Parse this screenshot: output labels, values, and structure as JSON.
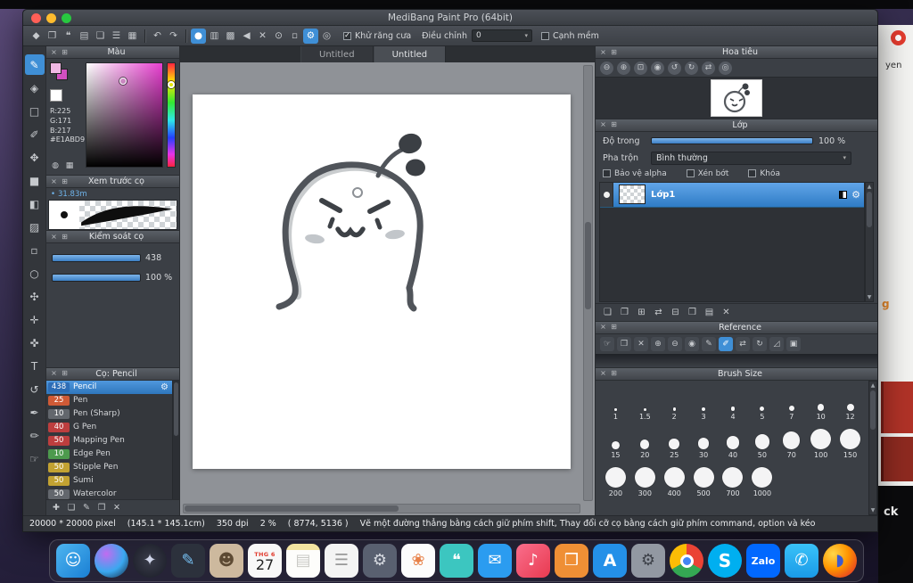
{
  "window": {
    "title": "MediBang Paint Pro (64bit)"
  },
  "toolbar": {
    "antialias_label": "Khử răng cưa",
    "antialias_checked": true,
    "adjust_label": "Điều chỉnh",
    "adjust_value": "0",
    "soft_edge_label": "Cạnh mềm",
    "soft_edge_checked": false,
    "icons": [
      {
        "name": "blob-select-icon",
        "glyph": "◆"
      },
      {
        "name": "transform-icon",
        "glyph": "❐"
      },
      {
        "name": "speech-bubble-icon",
        "glyph": "❝"
      },
      {
        "name": "text-panel-icon",
        "glyph": "▤"
      },
      {
        "name": "page-icon",
        "glyph": "❏"
      },
      {
        "name": "list-icon",
        "glyph": "☰"
      },
      {
        "name": "grid-icon",
        "glyph": "▦"
      },
      {
        "sep": true
      },
      {
        "name": "undo-icon",
        "glyph": "↶"
      },
      {
        "name": "redo-icon",
        "glyph": "↷"
      },
      {
        "sep": true
      },
      {
        "name": "brush-circle-icon",
        "glyph": "●",
        "active": true
      },
      {
        "name": "gradient-icon",
        "glyph": "▥"
      },
      {
        "name": "pattern-icon",
        "glyph": "▩"
      },
      {
        "name": "snap-left-icon",
        "glyph": "◀"
      },
      {
        "name": "cross-snap-icon",
        "glyph": "✕"
      },
      {
        "name": "rotate-canvas-icon",
        "glyph": "⊙"
      },
      {
        "name": "select-rect-icon",
        "glyph": "▫"
      },
      {
        "name": "brush-settings-icon",
        "glyph": "⚙",
        "active": true
      },
      {
        "name": "circle-tool-icon",
        "glyph": "◎"
      }
    ]
  },
  "toolstrip": {
    "tools": [
      {
        "name": "pen-tool",
        "glyph": "✎",
        "active": true
      },
      {
        "name": "eraser-tool",
        "glyph": "◈"
      },
      {
        "name": "marquee-tool",
        "glyph": "□"
      },
      {
        "name": "brush-tool",
        "glyph": "✐"
      },
      {
        "name": "move-tool",
        "glyph": "✥"
      },
      {
        "name": "fill-rect-tool",
        "glyph": "■"
      },
      {
        "name": "bucket-tool",
        "glyph": "◧"
      },
      {
        "name": "gradient-tool",
        "glyph": "▨"
      },
      {
        "name": "select-tool",
        "glyph": "▫"
      },
      {
        "name": "lasso-tool",
        "glyph": "○"
      },
      {
        "name": "magic-wand-tool",
        "glyph": "✣"
      },
      {
        "name": "divide-tool",
        "glyph": "✛"
      },
      {
        "name": "eyedropper-tool",
        "glyph": "✜"
      },
      {
        "name": "text-tool",
        "glyph": "T"
      },
      {
        "name": "rotate-tool",
        "glyph": "↺"
      },
      {
        "name": "pen2-tool",
        "glyph": "✒"
      },
      {
        "name": "pencil-tool",
        "glyph": "✏"
      },
      {
        "name": "hand-tool",
        "glyph": "☞"
      }
    ]
  },
  "tabs": [
    {
      "label": "Untitled"
    },
    {
      "label": "Untitled",
      "active": true
    }
  ],
  "panels": {
    "color": {
      "title": "Màu",
      "r": "R:225",
      "g": "G:171",
      "b": "B:217",
      "hex": "#E1ABD9",
      "icons": [
        {
          "name": "web-color-icon",
          "glyph": "◍"
        },
        {
          "name": "palette-icon",
          "glyph": "▦"
        }
      ]
    },
    "preview": {
      "title": "Xem trước cọ",
      "size_label": "31.83m"
    },
    "control": {
      "title": "Kiểm soát cọ",
      "slider1_value": "438",
      "slider2_value": "100 %"
    },
    "brushes": {
      "title": "Cọ: Pencil",
      "items": [
        {
          "size": "438",
          "name": "Pencil",
          "selected": true,
          "chip": "#2e6db6"
        },
        {
          "size": "25",
          "name": "Pen",
          "chip": "#cf5a36"
        },
        {
          "size": "10",
          "name": "Pen (Sharp)",
          "chip": "#63676d"
        },
        {
          "size": "40",
          "name": "G Pen",
          "chip": "#bd3e3e"
        },
        {
          "size": "50",
          "name": "Mapping Pen",
          "chip": "#bd3e3e"
        },
        {
          "size": "10",
          "name": "Edge Pen",
          "chip": "#4d9a4d"
        },
        {
          "size": "50",
          "name": "Stipple Pen",
          "chip": "#c2a232"
        },
        {
          "size": "50",
          "name": "Sumi",
          "chip": "#c2a232"
        },
        {
          "size": "50",
          "name": "Watercolor",
          "chip": "#63676d"
        }
      ],
      "toolbar_icons": [
        {
          "name": "add-brush-icon",
          "glyph": "✚"
        },
        {
          "name": "duplicate-brush-icon",
          "glyph": "❏"
        },
        {
          "name": "edit-brush-icon",
          "glyph": "✎"
        },
        {
          "name": "brush-folder-icon",
          "glyph": "❒"
        },
        {
          "name": "delete-brush-icon",
          "glyph": "✕"
        }
      ]
    },
    "navigator": {
      "title": "Hoa tiêu",
      "icons": [
        {
          "name": "zoom-out-icon",
          "glyph": "⊖"
        },
        {
          "name": "zoom-in-icon",
          "glyph": "⊕"
        },
        {
          "name": "fit-window-icon",
          "glyph": "⊡"
        },
        {
          "name": "actual-size-icon",
          "glyph": "◉"
        },
        {
          "name": "rotate-left-icon",
          "glyph": "↺"
        },
        {
          "name": "rotate-right-icon",
          "glyph": "↻"
        },
        {
          "name": "flip-icon",
          "glyph": "⇄"
        },
        {
          "name": "reset-view-icon",
          "glyph": "◎"
        }
      ]
    },
    "layer": {
      "title": "Lớp",
      "opacity_label": "Độ trong",
      "opacity_value": "100 %",
      "blend_label": "Pha trộn",
      "blend_value": "Bình thường",
      "alpha_protect_label": "Bảo vệ alpha",
      "clipping_label": "Xén bớt",
      "lock_label": "Khóa",
      "layers": [
        {
          "name": "Lớp1",
          "selected": true,
          "visible": true
        }
      ],
      "toolbar_icons": [
        {
          "name": "add-layer-icon",
          "glyph": "❏"
        },
        {
          "name": "add-folder-icon",
          "glyph": "❐"
        },
        {
          "name": "duplicate-layer-icon",
          "glyph": "⊞"
        },
        {
          "name": "transfer-layer-icon",
          "glyph": "⇄"
        },
        {
          "name": "merge-layer-icon",
          "glyph": "⊟"
        },
        {
          "name": "layer-folder-icon",
          "glyph": "❒"
        },
        {
          "name": "layer-list-icon",
          "glyph": "▤"
        },
        {
          "name": "delete-layer-icon",
          "glyph": "✕"
        }
      ]
    },
    "reference": {
      "title": "Reference",
      "icons": [
        {
          "name": "hand-icon",
          "glyph": "☞"
        },
        {
          "name": "ref-folder-icon",
          "glyph": "❒"
        },
        {
          "name": "close-ref-icon",
          "glyph": "✕"
        },
        {
          "name": "ref-zoom-in-icon",
          "glyph": "⊕"
        },
        {
          "name": "ref-zoom-out-icon",
          "glyph": "⊖"
        },
        {
          "name": "ref-actual-icon",
          "glyph": "◉"
        },
        {
          "name": "ref-pen-icon",
          "glyph": "✎"
        },
        {
          "name": "ref-pick-icon",
          "glyph": "✐",
          "active": true
        },
        {
          "name": "ref-flip-icon",
          "glyph": "⇄"
        },
        {
          "name": "ref-rotate-icon",
          "glyph": "↻"
        },
        {
          "name": "ref-angle-icon",
          "glyph": "◿"
        },
        {
          "name": "ref-grid-icon",
          "glyph": "▣"
        }
      ]
    },
    "brush_size": {
      "title": "Brush Size",
      "sizes": [
        "1",
        "1.5",
        "2",
        "3",
        "4",
        "5",
        "7",
        "10",
        "12",
        "15",
        "20",
        "25",
        "30",
        "40",
        "50",
        "70",
        "100",
        "150",
        "200",
        "300",
        "400",
        "500",
        "700",
        "1000"
      ]
    }
  },
  "status": {
    "size": "20000 * 20000 pixel",
    "dimensions": "(145.1 * 145.1cm)",
    "dpi": "350 dpi",
    "zoom": "2 %",
    "coords": "( 8774, 5136 )",
    "hint": "Vẽ một đường thẳng bằng cách giữ phím shift, Thay đổi cỡ cọ bằng cách giữ phím command, option và kéo"
  },
  "desktop": {
    "fragment_yen": "yen",
    "fragment_g": "g",
    "fragment_ck": "ck"
  },
  "dock": {
    "calendar": {
      "month": "THG 6",
      "day": "27"
    },
    "items": [
      {
        "name": "finder",
        "bg": "linear-gradient(135deg,#4db5f0,#1a7fd4)",
        "glyph": "☺",
        "fg": "#fff"
      },
      {
        "name": "siri",
        "bg": "radial-gradient(circle at 35% 30%,#c06cf0,#3aa8f0 55%,#16233a)",
        "round": true
      },
      {
        "name": "launchpad",
        "bg": "radial-gradient(circle,#3a3d4a,#191b26)",
        "glyph": "✦",
        "fg": "#cfd4e8",
        "round": true
      },
      {
        "name": "design-app",
        "bg": "#2c313c",
        "glyph": "✎",
        "fg": "#76c0f2"
      },
      {
        "name": "contacts",
        "bg": "#cdb99e",
        "glyph": "☻",
        "fg": "#5d4a33"
      },
      {
        "name": "calendar",
        "bg": "#f8f8f8",
        "calendar": true
      },
      {
        "name": "notes",
        "bg": "linear-gradient(#f3e3a0 18%,#fdfdfb 18%)",
        "glyph": "▤",
        "fg": "#c9c9c4"
      },
      {
        "name": "reminders",
        "bg": "#f4f4f4",
        "glyph": "☰",
        "fg": "#999999"
      },
      {
        "name": "automator",
        "bg": "#596070",
        "glyph": "⚙",
        "fg": "#d6d9e0"
      },
      {
        "name": "photos",
        "bg": "#fcfcfc",
        "glyph": "❀",
        "fg": "#e8824a"
      },
      {
        "name": "messages",
        "bg": "#3cc6c0",
        "glyph": "❝",
        "fg": "#ffffff"
      },
      {
        "name": "mail",
        "bg": "#2b9cf0",
        "glyph": "✉",
        "fg": "#ffffff"
      },
      {
        "name": "music",
        "bg": "linear-gradient(135deg,#fa6e8c,#e83a50)",
        "glyph": "♪",
        "fg": "#ffffff"
      },
      {
        "name": "books",
        "bg": "#ef8f35",
        "glyph": "❒",
        "fg": "#ffffff"
      },
      {
        "name": "app-store",
        "bg": "#2490e8",
        "text": "A",
        "fg": "#ffffff",
        "fs": "19px"
      },
      {
        "name": "system-preferences",
        "bg": "#9298a2",
        "glyph": "⚙",
        "fg": "#3c4048"
      },
      {
        "name": "chrome",
        "bg": "conic-gradient(#ea4335 0 120deg,#34a853 120deg 240deg,#fbbc05 240deg 360deg)",
        "round": true,
        "center": true
      },
      {
        "name": "skype",
        "bg": "#00aff0",
        "text": "S",
        "fg": "#ffffff",
        "fs": "20px",
        "round": true
      },
      {
        "name": "zalo",
        "bg": "#0168ff",
        "text": "Zalo",
        "fg": "#ffffff",
        "fs": "11px"
      },
      {
        "name": "facetime",
        "bg": "linear-gradient(#39c2f8,#1a9ae8)",
        "glyph": "✆",
        "fg": "#ffffff"
      },
      {
        "name": "firefox",
        "bg": "radial-gradient(circle at 30% 30%,#ffd74a,#ff9500 45%,#e8481f 80%)",
        "round": true,
        "glyph": "◗",
        "fg": "#3b5bd0"
      }
    ]
  }
}
